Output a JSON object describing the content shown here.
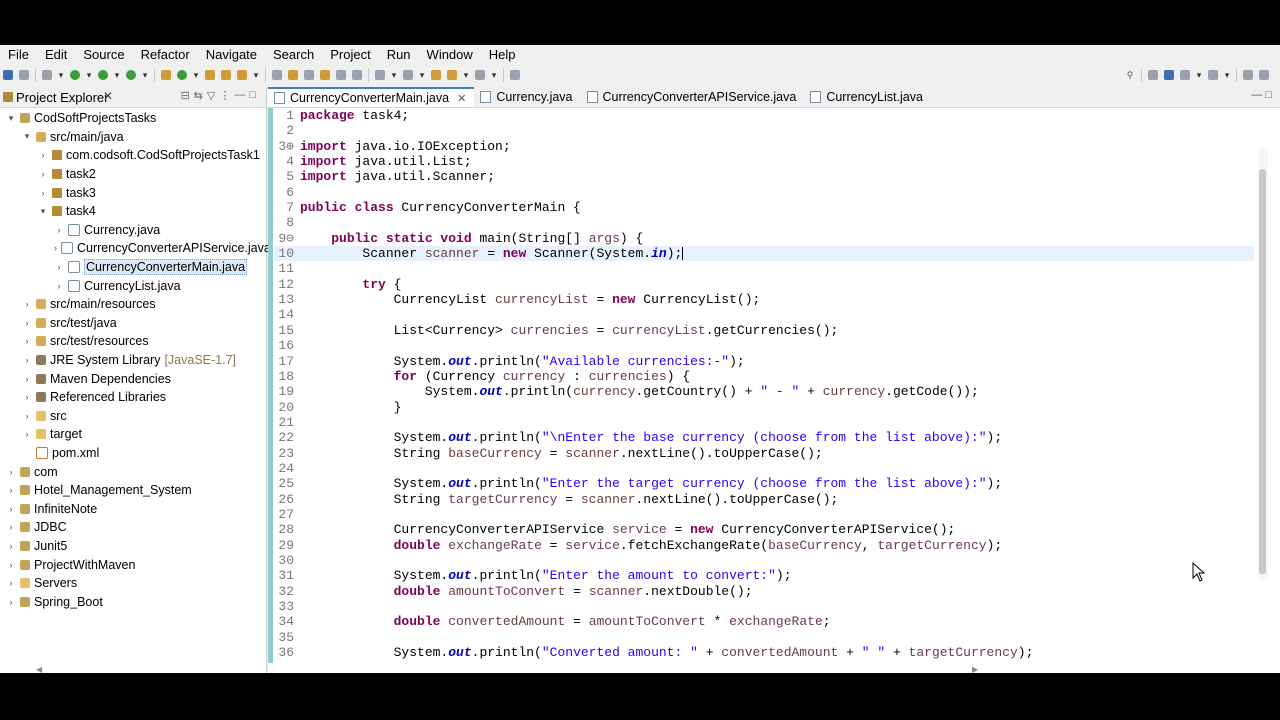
{
  "menu": [
    "File",
    "Edit",
    "Source",
    "Refactor",
    "Navigate",
    "Search",
    "Project",
    "Run",
    "Window",
    "Help"
  ],
  "explorer": {
    "title": "Project Explorer",
    "tree": [
      {
        "label": "CodSoftProjectsTasks",
        "level": 0,
        "tw": "▾",
        "icon": "proj"
      },
      {
        "label": "src/main/java",
        "level": 1,
        "tw": "▾",
        "icon": "srcf"
      },
      {
        "label": "com.codsoft.CodSoftProjectsTask1",
        "level": 2,
        "tw": "›",
        "icon": "pkg"
      },
      {
        "label": "task2",
        "level": 2,
        "tw": "›",
        "icon": "pkg"
      },
      {
        "label": "task3",
        "level": 2,
        "tw": "›",
        "icon": "pkg"
      },
      {
        "label": "task4",
        "level": 2,
        "tw": "▾",
        "icon": "pkg"
      },
      {
        "label": "Currency.java",
        "level": 3,
        "tw": "›",
        "icon": "java"
      },
      {
        "label": "CurrencyConverterAPIService.java",
        "level": 3,
        "tw": "›",
        "icon": "java"
      },
      {
        "label": "CurrencyConverterMain.java",
        "level": 3,
        "tw": "›",
        "icon": "java",
        "selected": true
      },
      {
        "label": "CurrencyList.java",
        "level": 3,
        "tw": "›",
        "icon": "java"
      },
      {
        "label": "src/main/resources",
        "level": 1,
        "tw": "›",
        "icon": "srcf"
      },
      {
        "label": "src/test/java",
        "level": 1,
        "tw": "›",
        "icon": "srcf"
      },
      {
        "label": "src/test/resources",
        "level": 1,
        "tw": "›",
        "icon": "srcf"
      },
      {
        "label": "JRE System Library",
        "level": 1,
        "tw": "›",
        "icon": "lib",
        "decoration": "[JavaSE-1.7]"
      },
      {
        "label": "Maven Dependencies",
        "level": 1,
        "tw": "›",
        "icon": "lib"
      },
      {
        "label": "Referenced Libraries",
        "level": 1,
        "tw": "›",
        "icon": "lib"
      },
      {
        "label": "src",
        "level": 1,
        "tw": "›",
        "icon": "fold"
      },
      {
        "label": "target",
        "level": 1,
        "tw": "›",
        "icon": "fold"
      },
      {
        "label": "pom.xml",
        "level": 1,
        "tw": "",
        "icon": "xml"
      },
      {
        "label": "com",
        "level": 0,
        "tw": "›",
        "icon": "proj"
      },
      {
        "label": "Hotel_Management_System",
        "level": 0,
        "tw": "›",
        "icon": "proj"
      },
      {
        "label": "InfiniteNote",
        "level": 0,
        "tw": "›",
        "icon": "proj"
      },
      {
        "label": "JDBC",
        "level": 0,
        "tw": "›",
        "icon": "proj"
      },
      {
        "label": "Junit5",
        "level": 0,
        "tw": "›",
        "icon": "proj"
      },
      {
        "label": "ProjectWithMaven",
        "level": 0,
        "tw": "›",
        "icon": "proj"
      },
      {
        "label": "Servers",
        "level": 0,
        "tw": "›",
        "icon": "fold"
      },
      {
        "label": "Spring_Boot",
        "level": 0,
        "tw": "›",
        "icon": "proj"
      }
    ]
  },
  "editor": {
    "tabs": [
      {
        "label": "CurrencyConverterMain.java",
        "active": true
      },
      {
        "label": "Currency.java"
      },
      {
        "label": "CurrencyConverterAPIService.java"
      },
      {
        "label": "CurrencyList.java"
      }
    ],
    "current_line": 10,
    "lines": [
      {
        "n": "1",
        "html": "<span class=\"k\">package</span> task4;"
      },
      {
        "n": "2",
        "html": ""
      },
      {
        "n": "3⊕",
        "html": "<span class=\"k\">import</span> java.io.IOException;"
      },
      {
        "n": "4",
        "html": "<span class=\"k\">import</span> java.util.List;"
      },
      {
        "n": "5",
        "html": "<span class=\"k\">import</span> java.util.Scanner;"
      },
      {
        "n": "6",
        "html": ""
      },
      {
        "n": "7",
        "html": "<span class=\"k\">public class</span> CurrencyConverterMain {"
      },
      {
        "n": "8",
        "html": ""
      },
      {
        "n": "9⊖",
        "html": "    <span class=\"k\">public static void</span> main(String[] <span class=\"v\">args</span>) {"
      },
      {
        "n": "10",
        "html": "        Scanner <span class=\"v\">scanner</span> = <span class=\"k\">new</span> Scanner(System.<span class=\"f\">in</span>);<span class=\"caret\"></span>"
      },
      {
        "n": "11",
        "html": ""
      },
      {
        "n": "12",
        "html": "        <span class=\"k\">try</span> {"
      },
      {
        "n": "13",
        "html": "            CurrencyList <span class=\"v\">currencyList</span> = <span class=\"k\">new</span> CurrencyList();"
      },
      {
        "n": "14",
        "html": ""
      },
      {
        "n": "15",
        "html": "            List&lt;Currency&gt; <span class=\"v\">currencies</span> = <span class=\"v\">currencyList</span>.getCurrencies();"
      },
      {
        "n": "16",
        "html": ""
      },
      {
        "n": "17",
        "html": "            System.<span class=\"f\">out</span>.println(<span class=\"s\">\"Available currencies:-\"</span>);"
      },
      {
        "n": "18",
        "html": "            <span class=\"k\">for</span> (Currency <span class=\"v\">currency</span> : <span class=\"v\">currencies</span>) {"
      },
      {
        "n": "19",
        "html": "                System.<span class=\"f\">out</span>.println(<span class=\"v\">currency</span>.getCountry() + <span class=\"s\">\" - \"</span> + <span class=\"v\">currency</span>.getCode());"
      },
      {
        "n": "20",
        "html": "            }"
      },
      {
        "n": "21",
        "html": ""
      },
      {
        "n": "22",
        "html": "            System.<span class=\"f\">out</span>.println(<span class=\"s\">\"\\nEnter the base currency (choose from the list above):\"</span>);"
      },
      {
        "n": "23",
        "html": "            String <span class=\"v\">baseCurrency</span> = <span class=\"v\">scanner</span>.nextLine().toUpperCase();"
      },
      {
        "n": "24",
        "html": ""
      },
      {
        "n": "25",
        "html": "            System.<span class=\"f\">out</span>.println(<span class=\"s\">\"Enter the target currency (choose from the list above):\"</span>);"
      },
      {
        "n": "26",
        "html": "            String <span class=\"v\">targetCurrency</span> = <span class=\"v\">scanner</span>.nextLine().toUpperCase();"
      },
      {
        "n": "27",
        "html": ""
      },
      {
        "n": "28",
        "html": "            CurrencyConverterAPIService <span class=\"v\">service</span> = <span class=\"k\">new</span> CurrencyConverterAPIService();"
      },
      {
        "n": "29",
        "html": "            <span class=\"k\">double</span> <span class=\"v\">exchangeRate</span> = <span class=\"v\">service</span>.fetchExchangeRate(<span class=\"v\">baseCurrency</span>, <span class=\"v\">targetCurrency</span>);"
      },
      {
        "n": "30",
        "html": ""
      },
      {
        "n": "31",
        "html": "            System.<span class=\"f\">out</span>.println(<span class=\"s\">\"Enter the amount to convert:\"</span>);"
      },
      {
        "n": "32",
        "html": "            <span class=\"k\">double</span> <span class=\"v\">amountToConvert</span> = <span class=\"v\">scanner</span>.nextDouble();"
      },
      {
        "n": "33",
        "html": ""
      },
      {
        "n": "34",
        "html": "            <span class=\"k\">double</span> <span class=\"v\">convertedAmount</span> = <span class=\"v\">amountToConvert</span> * <span class=\"v\">exchangeRate</span>;"
      },
      {
        "n": "35",
        "html": ""
      },
      {
        "n": "36",
        "html": "            System.<span class=\"f\">out</span>.println(<span class=\"s\">\"Converted amount: \"</span> + <span class=\"v\">convertedAmount</span> + <span class=\"s\">\" \"</span> + <span class=\"v\">targetCurrency</span>);"
      }
    ]
  }
}
